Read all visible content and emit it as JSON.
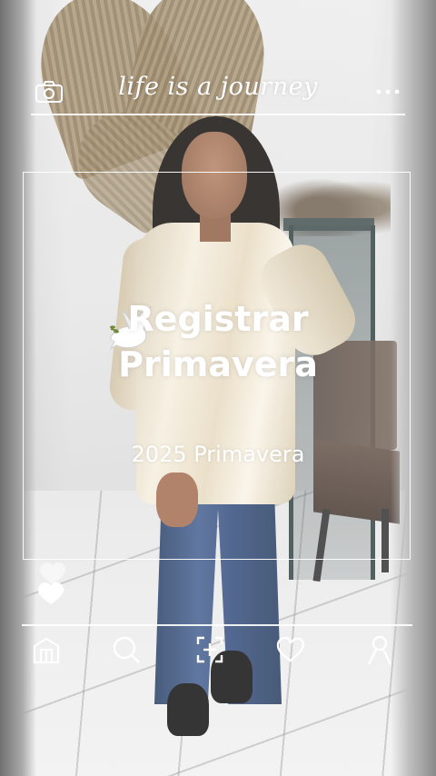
{
  "app": {
    "brand_text": "life is a journey"
  },
  "header": {
    "camera_icon": "camera-icon",
    "more_icon": "more-dots-icon"
  },
  "post": {
    "title_line1": "Registrar",
    "title_line2": "Primavera",
    "subtitle": "2025 Primavera",
    "title_emoji_icon": "dove-icon",
    "like_icon": "heart-icon"
  },
  "nav": {
    "items": [
      {
        "icon": "home-icon"
      },
      {
        "icon": "search-icon"
      },
      {
        "icon": "add-post-icon"
      },
      {
        "icon": "likes-icon"
      },
      {
        "icon": "profile-icon"
      }
    ]
  },
  "colors": {
    "overlay_text": "#ffffff",
    "shirt": "#f3ebdc",
    "jeans": "#3c5482"
  }
}
